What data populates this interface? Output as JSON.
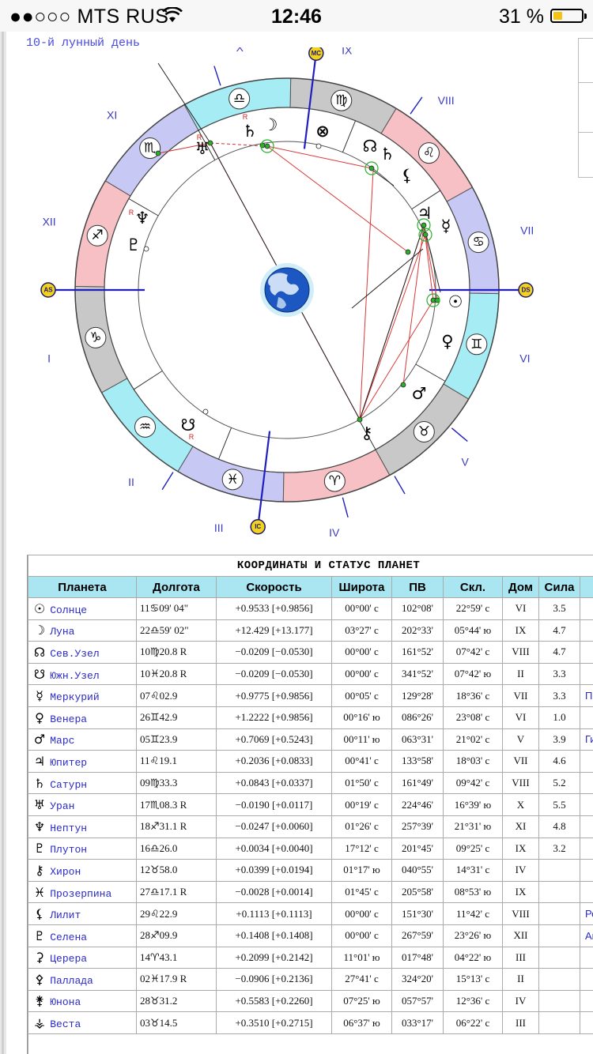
{
  "status_bar": {
    "carrier": "●●○○○ MTS RUS",
    "wifi_icon": "wifi-icon",
    "time": "12:46",
    "battery_text": "31 %",
    "battery_level": 0.31,
    "battery_color": "#f4c316"
  },
  "lunar_day": "10-й лунный день",
  "chart": {
    "houses": [
      "I",
      "II",
      "III",
      "IV",
      "V",
      "VI",
      "VII",
      "VIII",
      "IX",
      "X",
      "XI",
      "XII"
    ],
    "axes": [
      "AS",
      "MC",
      "DS",
      "IC"
    ],
    "signs": [
      "♑",
      "♒",
      "♓",
      "♈",
      "♉",
      "♊",
      "♋",
      "♌",
      "♍",
      "♎",
      "♏",
      "♐"
    ],
    "planets": [
      "☉",
      "☽",
      "☊",
      "☋",
      "☿",
      "♀",
      "♂",
      "♃",
      "♄",
      "♅",
      "♆",
      "♇",
      "⚷",
      "♄",
      "⚸",
      "⊗"
    ],
    "retro_mark": "R",
    "center_icon": "earth-globe-icon"
  },
  "table": {
    "title": "КООРДИНАТЫ И СТАТУС ПЛАНЕТ",
    "headers": [
      "Планета",
      "Долгота",
      "Скорость",
      "Широта",
      "ПВ",
      "Скл.",
      "Дом",
      "Сила",
      "Но"
    ],
    "rows": [
      {
        "glyph": "☉",
        "name": "Солнце",
        "deg": "11",
        "sign": "♋",
        "min": "09' 04\"",
        "speed": "+0.9533  [+0.9856]",
        "lat": "00°00' с",
        "ra": "102°08'",
        "decl": "22°59' с",
        "house": "VI",
        "power": "3.5",
        "extra": ""
      },
      {
        "glyph": "☽",
        "name": "Луна",
        "deg": "22",
        "sign": "♎",
        "min": "59' 02\"",
        "speed": "+12.429  [+13.177]",
        "lat": "03°27' с",
        "ra": "202°33'",
        "decl": "05°44' ю",
        "house": "IX",
        "power": "4.7",
        "extra": ""
      },
      {
        "glyph": "☊",
        "name": "Сев.Узел",
        "deg": "10",
        "sign": "♍",
        "min": "20.8  R",
        "speed": "−0.0209  [−0.0530]",
        "lat": "00°00' с",
        "ra": "161°52'",
        "decl": "07°42' с",
        "house": "VIII",
        "power": "4.7",
        "extra": ""
      },
      {
        "glyph": "☋",
        "name": "Южн.Узел",
        "deg": "10",
        "sign": "♓",
        "min": "20.8  R",
        "speed": "−0.0209  [−0.0530]",
        "lat": "00°00' с",
        "ra": "341°52'",
        "decl": "07°42' ю",
        "house": "II",
        "power": "3.3",
        "extra": ""
      },
      {
        "glyph": "☿",
        "name": "Меркурий",
        "deg": "07",
        "sign": "♌",
        "min": "02.9",
        "speed": "+0.9775  [+0.9856]",
        "lat": "00°05' с",
        "ra": "129°28'",
        "decl": "18°36' с",
        "house": "VII",
        "power": "3.3",
        "extra": "Пр"
      },
      {
        "glyph": "♀",
        "name": "Венера",
        "deg": "26",
        "sign": "♊",
        "min": "42.9",
        "speed": "+1.2222  [+0.9856]",
        "lat": "00°16' ю",
        "ra": "086°26'",
        "decl": "23°08' с",
        "house": "VI",
        "power": "1.0",
        "extra": ""
      },
      {
        "glyph": "♂",
        "name": "Марс",
        "deg": "05",
        "sign": "♊",
        "min": "23.9",
        "speed": "+0.7069  [+0.5243]",
        "lat": "00°11' ю",
        "ra": "063°31'",
        "decl": "21°02' с",
        "house": "V",
        "power": "3.9",
        "extra": "Ги"
      },
      {
        "glyph": "♃",
        "name": "Юпитер",
        "deg": "11",
        "sign": "♌",
        "min": "19.1",
        "speed": "+0.2036  [+0.0833]",
        "lat": "00°41' с",
        "ra": "133°58'",
        "decl": "18°03' с",
        "house": "VII",
        "power": "4.6",
        "extra": ""
      },
      {
        "glyph": "♄",
        "name": "Сатурн",
        "deg": "09",
        "sign": "♍",
        "min": "33.3",
        "speed": "+0.0843  [+0.0337]",
        "lat": "01°50' с",
        "ra": "161°49'",
        "decl": "09°42' с",
        "house": "VIII",
        "power": "5.2",
        "extra": ""
      },
      {
        "glyph": "♅",
        "name": "Уран",
        "deg": "17",
        "sign": "♏",
        "min": "08.3  R",
        "speed": "−0.0190  [+0.0117]",
        "lat": "00°19' с",
        "ra": "224°46'",
        "decl": "16°39' ю",
        "house": "X",
        "power": "5.5",
        "extra": ""
      },
      {
        "glyph": "♆",
        "name": "Нептун",
        "deg": "18",
        "sign": "♐",
        "min": "31.1  R",
        "speed": "−0.0247  [+0.0060]",
        "lat": "01°26' с",
        "ra": "257°39'",
        "decl": "21°31' ю",
        "house": "XI",
        "power": "4.8",
        "extra": ""
      },
      {
        "glyph": "♇",
        "name": "Плутон",
        "deg": "16",
        "sign": "♎",
        "min": "26.0",
        "speed": "+0.0034  [+0.0040]",
        "lat": "17°12' с",
        "ra": "201°45'",
        "decl": "09°25' с",
        "house": "IX",
        "power": "3.2",
        "extra": ""
      },
      {
        "glyph": "⚷",
        "name": "Хирон",
        "deg": "12",
        "sign": "♉",
        "min": "58.0",
        "speed": "+0.0399  [+0.0194]",
        "lat": "01°17' ю",
        "ra": "040°55'",
        "decl": "14°31' с",
        "house": "IV",
        "power": "",
        "extra": ""
      },
      {
        "glyph": "♓",
        "name": "Прозерпина",
        "deg": "27",
        "sign": "♎",
        "min": "17.1  R",
        "speed": "−0.0028  [+0.0014]",
        "lat": "01°45' с",
        "ra": "205°58'",
        "decl": "08°53' ю",
        "house": "IX",
        "power": "",
        "extra": ""
      },
      {
        "glyph": "⚸",
        "name": "Лилит",
        "deg": "29",
        "sign": "♌",
        "min": "22.9",
        "speed": "+0.1113  [+0.1113]",
        "lat": "00°00' с",
        "ra": "151°30'",
        "decl": "11°42' с",
        "house": "VIII",
        "power": "",
        "extra": "Ре"
      },
      {
        "glyph": "♇",
        "name": "Селена",
        "deg": "28",
        "sign": "♐",
        "min": "09.9",
        "speed": "+0.1408  [+0.1408]",
        "lat": "00°00' с",
        "ra": "267°59'",
        "decl": "23°26' ю",
        "house": "XII",
        "power": "",
        "extra": "Ан"
      },
      {
        "glyph": "⚳",
        "name": "Церера",
        "deg": "14",
        "sign": "♈",
        "min": "43.1",
        "speed": "+0.2099  [+0.2142]",
        "lat": "11°01' ю",
        "ra": "017°48'",
        "decl": "04°22' ю",
        "house": "III",
        "power": "",
        "extra": ""
      },
      {
        "glyph": "⚴",
        "name": "Паллада",
        "deg": "02",
        "sign": "♓",
        "min": "17.9  R",
        "speed": "−0.0906  [+0.2136]",
        "lat": "27°41' с",
        "ra": "324°20'",
        "decl": "15°13' с",
        "house": "II",
        "power": "",
        "extra": ""
      },
      {
        "glyph": "⚵",
        "name": "Юнона",
        "deg": "28",
        "sign": "♉",
        "min": "31.2",
        "speed": "+0.5583  [+0.2260]",
        "lat": "07°25' ю",
        "ra": "057°57'",
        "decl": "12°36' с",
        "house": "IV",
        "power": "",
        "extra": ""
      },
      {
        "glyph": "⚶",
        "name": "Веста",
        "deg": "03",
        "sign": "♉",
        "min": "14.5",
        "speed": "+0.3510  [+0.2715]",
        "lat": "06°37' ю",
        "ra": "033°17'",
        "decl": "06°22' с",
        "house": "III",
        "power": "",
        "extra": ""
      }
    ]
  }
}
